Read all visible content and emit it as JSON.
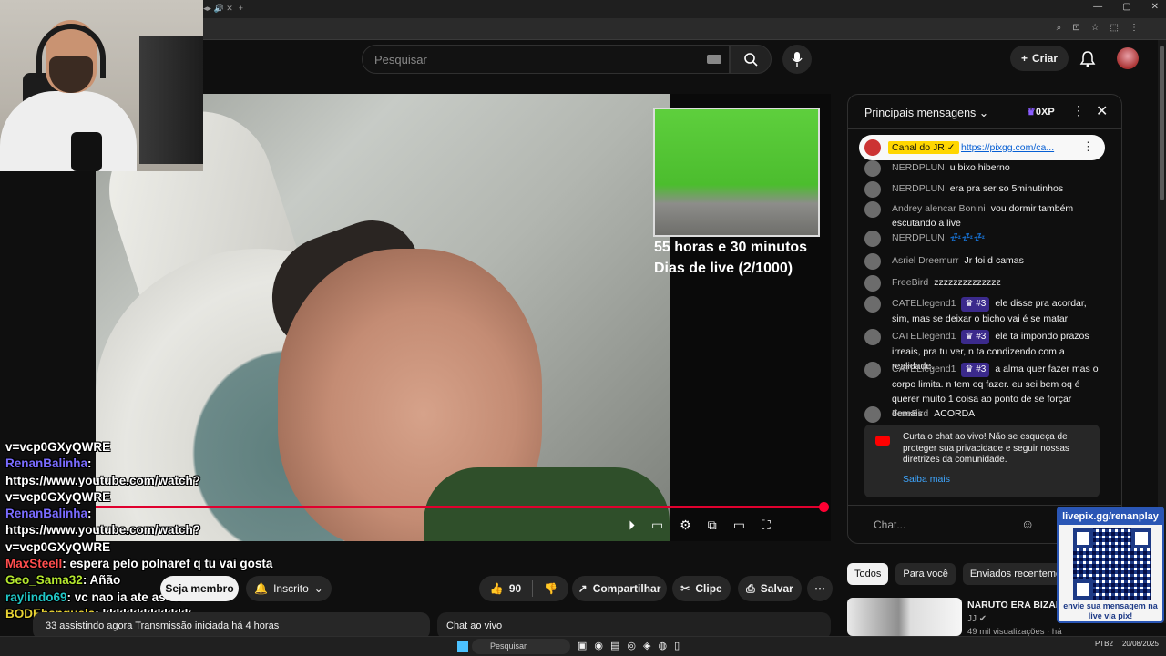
{
  "colors": {
    "accent": "#ff0033",
    "background": "#0f0f0f",
    "link": "#3ea6ff",
    "pinned_badge": "#ffd600",
    "member_badge": "#3b2a8c"
  },
  "header": {
    "search_placeholder": "Pesquisar",
    "create_label": "Criar"
  },
  "video": {
    "overlay_line1": "55 horas e 30 minutos",
    "overlay_line2": "Dias de live (2/1000)",
    "progress_fraction": 1.0
  },
  "stream_chat": [
    {
      "user": "",
      "text": "v=vcp0GXyQWRE"
    },
    {
      "user": "RenanBalinha",
      "text": ":"
    },
    {
      "user": "",
      "text": "https://www.youtube.com/watch?"
    },
    {
      "user": "",
      "text": "v=vcp0GXyQWRE"
    },
    {
      "user": "RenanBalinha",
      "text": ":"
    },
    {
      "user": "",
      "text": "https://www.youtube.com/watch?"
    },
    {
      "user": "",
      "text": "v=vcp0GXyQWRE"
    },
    {
      "user": "MaxSteell",
      "text": ": espera pelo polnaref q tu vai gosta"
    },
    {
      "user": "Geo_Sama32",
      "text": ": Añão"
    },
    {
      "user": "raylindo69",
      "text": ": vc nao ia ate as 3?"
    },
    {
      "user": "BODEbanguela",
      "text": ": kkkkkkkkkkkkk"
    }
  ],
  "actions": {
    "join_label": "Seja membro",
    "subscribed_label": "Inscrito",
    "like_count": "90",
    "share_label": "Compartilhar",
    "clip_label": "Clipe",
    "save_label": "Salvar"
  },
  "description": {
    "text": "33 assistindo agora  Transmissão iniciada há 4 horas"
  },
  "live_chat_box": {
    "label": "Chat ao vivo"
  },
  "chat": {
    "title": "Principais mensagens",
    "xp": "0XP",
    "pinned_channel": "Canal do JR",
    "pinned_url": "https://pixgg.com/ca...",
    "messages": [
      {
        "author": "NERDPLUN",
        "text": "u bixo hiberno",
        "badge": ""
      },
      {
        "author": "NERDPLUN",
        "text": "era pra ser so 5minutinhos",
        "badge": ""
      },
      {
        "author": "Andrey alencar Bonini",
        "text": "vou dormir também escutando a live",
        "badge": ""
      },
      {
        "author": "NERDPLUN",
        "text": "💤💤💤",
        "badge": ""
      },
      {
        "author": "Asriel Dreemurr",
        "text": "Jr foi d camas",
        "badge": ""
      },
      {
        "author": "FreeBird",
        "text": "zzzzzzzzzzzzzz",
        "badge": ""
      },
      {
        "author": "CATELlegend1",
        "text": "ele disse pra acordar, sim, mas se deixar o bicho vai é se matar",
        "badge": "#3"
      },
      {
        "author": "CATELlegend1",
        "text": "ele ta impondo prazos irreais, pra tu ver, n ta condizendo com a realidade.",
        "badge": "#3"
      },
      {
        "author": "CATELlegend1",
        "text": "a alma quer fazer mas o corpo limita. n tem oq fazer. eu sei bem oq é querer muito 1 coisa ao ponto de se forçar demais",
        "badge": "#3"
      },
      {
        "author": "FreeBird",
        "text": "ACORDA",
        "badge": ""
      }
    ],
    "notice_text": "Curta o chat ao vivo! Não se esqueça de proteger sua privacidade e seguir nossas diretrizes da comunidade.",
    "notice_link": "Saiba mais",
    "input_placeholder": "Chat..."
  },
  "chips": [
    "Todos",
    "Para você",
    "Enviados recentemente"
  ],
  "recommendation": {
    "title": "NARUTO ERA BIZARRO",
    "channel": "JJ",
    "views": "49 mil visualizações · há"
  },
  "qr": {
    "header": "livepix.gg/renanplay",
    "footer": "envie sua mensagem na live via pix!"
  },
  "taskbar": {
    "search": "Pesquisar",
    "tray_left": "PTB2",
    "date": "20/08/2025"
  }
}
